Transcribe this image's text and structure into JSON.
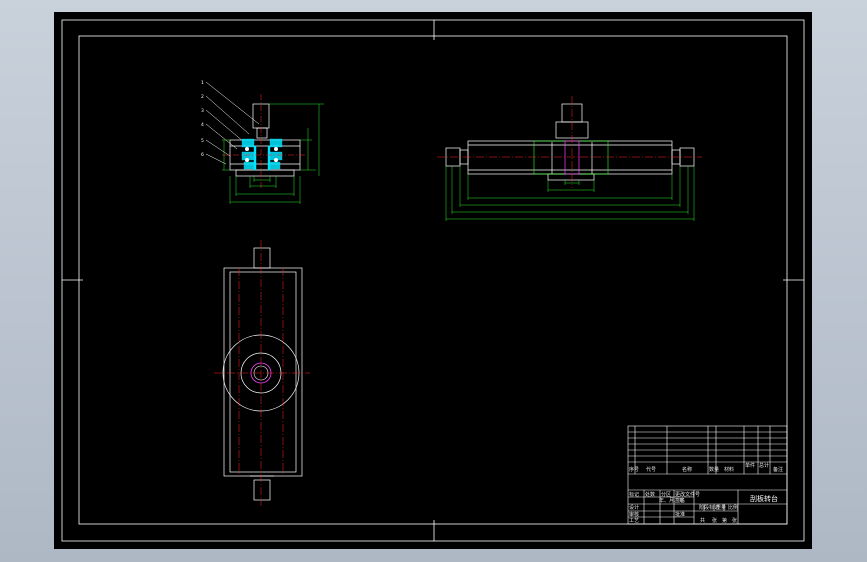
{
  "drawing": {
    "colors": {
      "background": "#000000",
      "outline": "#ffffff",
      "centerline": "#ff2020",
      "dimension": "#30ff30",
      "section_fill": "#00e5ff",
      "bore": "#ff40ff"
    },
    "side_view_leader_numbers": [
      "1",
      "2",
      "3",
      "4",
      "5",
      "6"
    ],
    "title_block": {
      "drawing_title": "刮板转台",
      "header_labels": [
        "序号",
        "代号",
        "名称",
        "数量",
        "材料",
        "单件",
        "总计",
        "备注"
      ],
      "sign_labels": [
        "标记",
        "处数",
        "分区",
        "更改文件号",
        "签名",
        "年、月、日"
      ],
      "role_labels": [
        "设计",
        "审核",
        "工艺",
        "批准"
      ],
      "stage_labels": [
        "阶段标记",
        "重量",
        "比例"
      ],
      "sheet_labels": [
        "共",
        "张",
        "第",
        "张"
      ]
    }
  }
}
